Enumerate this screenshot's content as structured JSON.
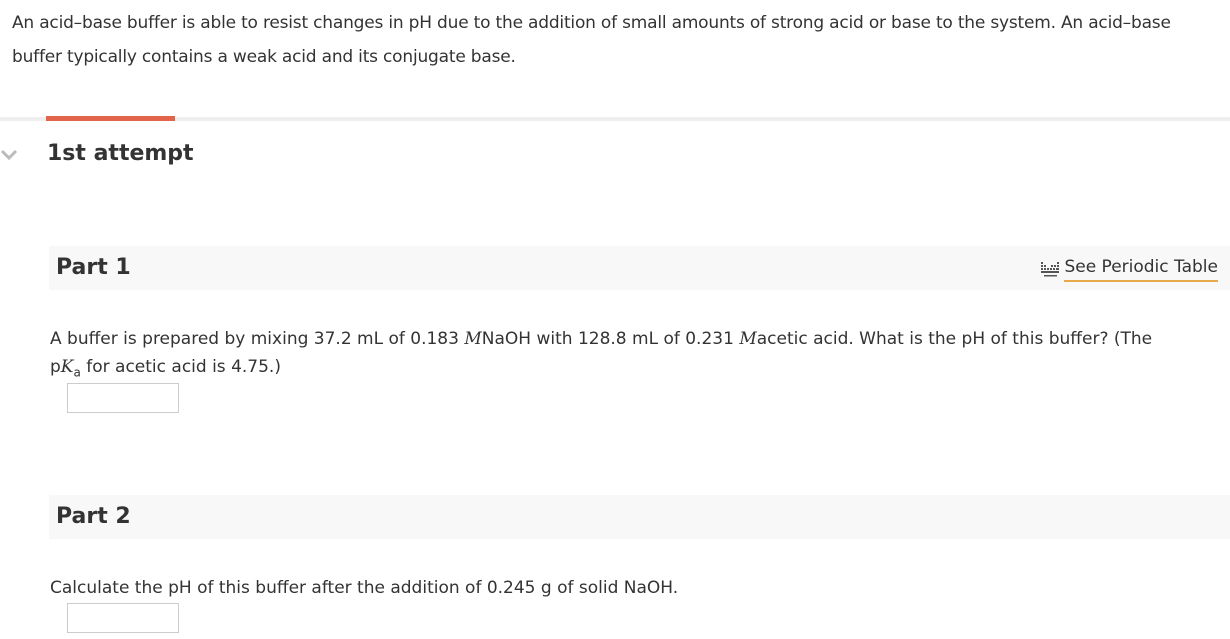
{
  "intro": {
    "text": "An acid–base buffer is able to resist changes in pH due to the addition of small amounts of strong acid or base to the system. An acid–base buffer typically contains a weak acid and its conjugate base."
  },
  "attempt": {
    "label": "1st attempt"
  },
  "periodic_table": {
    "label": "See Periodic Table",
    "icon": "periodic-table-icon"
  },
  "part1": {
    "title": "Part 1",
    "q_before": "A buffer is prepared by mixing 37.2 mL of 0.183 ",
    "unit_m1": "M",
    "q_mid": "NaOH with 128.8  mL of 0.231 ",
    "unit_m2": "M",
    "q_after": "acetic acid. What is the pH of this buffer? (The ",
    "pka_p": "p",
    "pka_k": "K",
    "pka_sub": "a",
    "q_end": " for acetic acid is 4.75.)",
    "answer_value": ""
  },
  "part2": {
    "title": "Part 2",
    "question": "Calculate the pH of this buffer after the addition of 0.245  g of solid NaOH.",
    "answer_value": ""
  },
  "colors": {
    "accent": "#e2654b",
    "link_underline": "#e8a94a",
    "header_bg": "#f8f8f8"
  }
}
